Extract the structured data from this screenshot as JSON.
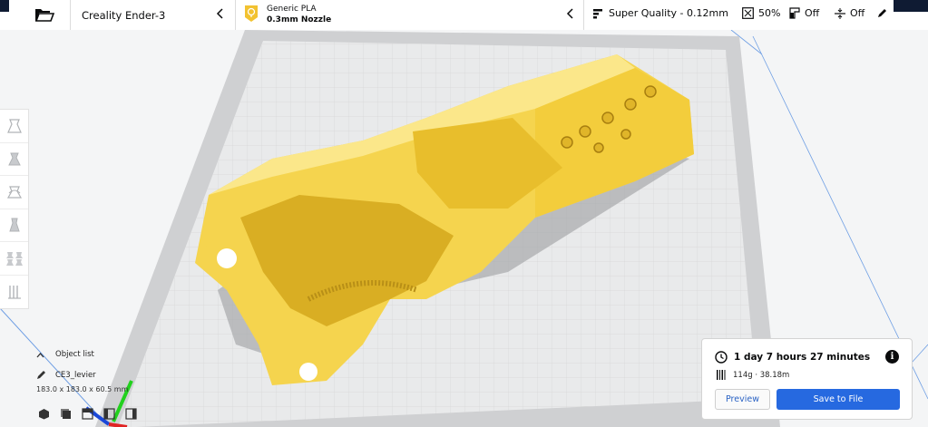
{
  "topbar": {
    "printer_name": "Creality Ender-3",
    "material_name": "Generic PLA",
    "nozzle": "0.3mm Nozzle",
    "profile": "Super Quality - 0.12mm",
    "infill": "50%",
    "support": "Off",
    "adhesion": "Off"
  },
  "object_list": {
    "title": "Object list",
    "object_name": "CE3_levier",
    "dimensions": "183.0 x 183.0 x 60.5 mm"
  },
  "print_panel": {
    "time": "1 day 7 hours 27 minutes",
    "material_usage": "114g · 38.18m",
    "preview_label": "Preview",
    "save_label": "Save to File"
  },
  "colors": {
    "model": "#f5d44e",
    "accent": "#2669e0",
    "badge": "#f2c230"
  }
}
